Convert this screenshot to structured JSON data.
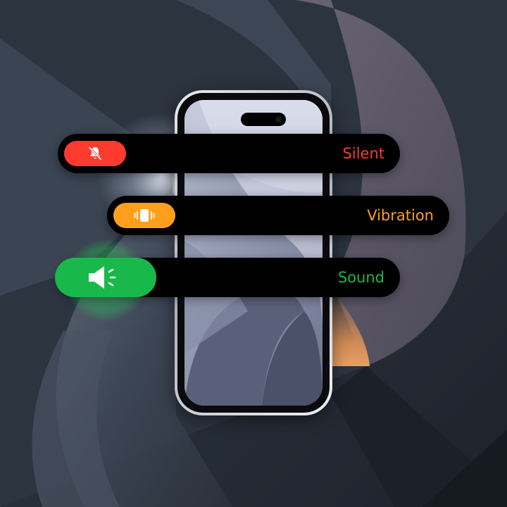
{
  "modes": {
    "silent": {
      "label": "Silent",
      "icon": "bell-slash-icon",
      "color": "#ff3b30"
    },
    "vibration": {
      "label": "Vibration",
      "icon": "vibration-icon",
      "color": "#ff9f1c"
    },
    "sound": {
      "label": "Sound",
      "icon": "speaker-icon",
      "color": "#19b84a",
      "selected": true
    }
  }
}
